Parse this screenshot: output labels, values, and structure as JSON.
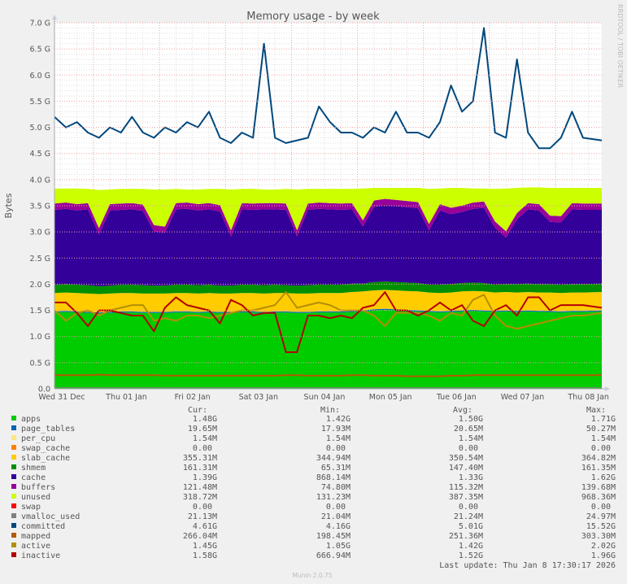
{
  "chart_data": {
    "type": "area",
    "title": "Memory usage - by week",
    "ylabel": "Bytes",
    "watermark": "RRDTOOL / TOBI OETIKER",
    "footer": "Munin 2.0.75",
    "last_update": "Last update: Thu Jan  8 17:30:17 2026",
    "ylim": [
      0,
      7.0
    ],
    "y_unit": "G",
    "y_ticks": [
      "0.0",
      "0.5 G",
      "1.0 G",
      "1.5 G",
      "2.0 G",
      "2.5 G",
      "3.0 G",
      "3.5 G",
      "4.0 G",
      "4.5 G",
      "5.0 G",
      "5.5 G",
      "6.0 G",
      "6.5 G",
      "7.0 G"
    ],
    "y_tick_values": [
      0,
      0.5,
      1.0,
      1.5,
      2.0,
      2.5,
      3.0,
      3.5,
      4.0,
      4.5,
      5.0,
      5.5,
      6.0,
      6.5,
      7.0
    ],
    "xlim": [
      "2025-12-31T09:50",
      "2026-01-08T16:50"
    ],
    "x_ticks": [
      {
        "label": "Wed 31 Dec",
        "t": "2025-12-31T12:00"
      },
      {
        "label": "Thu 01 Jan",
        "t": "2026-01-01T12:00"
      },
      {
        "label": "Fri 02 Jan",
        "t": "2026-01-02T12:00"
      },
      {
        "label": "Sat 03 Jan",
        "t": "2026-01-03T12:00"
      },
      {
        "label": "Sun 04 Jan",
        "t": "2026-01-04T12:00"
      },
      {
        "label": "Mon 05 Jan",
        "t": "2026-01-05T12:00"
      },
      {
        "label": "Tue 06 Jan",
        "t": "2026-01-06T12:00"
      },
      {
        "label": "Wed 07 Jan",
        "t": "2026-01-07T12:00"
      },
      {
        "label": "Thu 08 Jan",
        "t": "2026-01-08T12:00"
      }
    ],
    "grid": true,
    "x_start": "2025-12-31T10:00",
    "x_step_hours": 4,
    "legend_headers": [
      "Cur:",
      "Min:",
      "Avg:",
      "Max:"
    ],
    "series": [
      {
        "name": "apps",
        "color": "#00CC00",
        "draw": "area",
        "cur": "1.48G",
        "min": "1.42G",
        "avg": "1.50G",
        "max": "1.71G",
        "values": [
          1.46,
          1.47,
          1.46,
          1.45,
          1.44,
          1.45,
          1.46,
          1.46,
          1.45,
          1.45,
          1.45,
          1.46,
          1.46,
          1.45,
          1.46,
          1.45,
          1.45,
          1.46,
          1.46,
          1.45,
          1.46,
          1.46,
          1.45,
          1.45,
          1.46,
          1.46,
          1.46,
          1.47,
          1.48,
          1.5,
          1.51,
          1.5,
          1.49,
          1.48,
          1.47,
          1.46,
          1.47,
          1.48,
          1.49,
          1.48,
          1.47,
          1.48,
          1.47,
          1.48,
          1.47,
          1.47,
          1.46,
          1.47,
          1.47,
          1.48
        ]
      },
      {
        "name": "page_tables",
        "color": "#0066B3",
        "draw": "area",
        "cur": "19.65M",
        "min": "17.93M",
        "avg": "20.65M",
        "max": "50.27M",
        "values": [
          0.02,
          0.02,
          0.02,
          0.02,
          0.02,
          0.02,
          0.02,
          0.02,
          0.02,
          0.02,
          0.02,
          0.02,
          0.02,
          0.02,
          0.02,
          0.02,
          0.02,
          0.02,
          0.02,
          0.02,
          0.02,
          0.02,
          0.02,
          0.02,
          0.02,
          0.02,
          0.02,
          0.02,
          0.02,
          0.02,
          0.02,
          0.02,
          0.02,
          0.02,
          0.02,
          0.02,
          0.02,
          0.02,
          0.02,
          0.02,
          0.02,
          0.02,
          0.02,
          0.02,
          0.02,
          0.02,
          0.02,
          0.02,
          0.02,
          0.02
        ]
      },
      {
        "name": "per_cpu",
        "color": "#FFE680",
        "draw": "area",
        "cur": "1.54M",
        "min": "1.54M",
        "avg": "1.54M",
        "max": "1.54M",
        "values": [
          0.0015,
          0.0015,
          0.0015,
          0.0015,
          0.0015,
          0.0015,
          0.0015,
          0.0015,
          0.0015,
          0.0015,
          0.0015,
          0.0015,
          0.0015,
          0.0015,
          0.0015,
          0.0015,
          0.0015,
          0.0015,
          0.0015,
          0.0015,
          0.0015,
          0.0015,
          0.0015,
          0.0015,
          0.0015,
          0.0015,
          0.0015,
          0.0015,
          0.0015,
          0.0015,
          0.0015,
          0.0015,
          0.0015,
          0.0015,
          0.0015,
          0.0015,
          0.0015,
          0.0015,
          0.0015,
          0.0015,
          0.0015,
          0.0015,
          0.0015,
          0.0015,
          0.0015,
          0.0015,
          0.0015,
          0.0015,
          0.0015,
          0.0015
        ]
      },
      {
        "name": "swap_cache",
        "color": "#FF8000",
        "draw": "area",
        "cur": "0.00",
        "min": "0.00",
        "avg": "0.00",
        "max": "0.00",
        "values": [
          0,
          0,
          0,
          0,
          0,
          0,
          0,
          0,
          0,
          0,
          0,
          0,
          0,
          0,
          0,
          0,
          0,
          0,
          0,
          0,
          0,
          0,
          0,
          0,
          0,
          0,
          0,
          0,
          0,
          0,
          0,
          0,
          0,
          0,
          0,
          0,
          0,
          0,
          0,
          0,
          0,
          0,
          0,
          0,
          0,
          0,
          0,
          0,
          0,
          0
        ]
      },
      {
        "name": "slab_cache",
        "color": "#FFCC00",
        "draw": "area",
        "cur": "355.31M",
        "min": "344.94M",
        "avg": "350.54M",
        "max": "364.82M",
        "values": [
          0.35,
          0.35,
          0.35,
          0.35,
          0.35,
          0.35,
          0.35,
          0.35,
          0.35,
          0.35,
          0.35,
          0.35,
          0.35,
          0.35,
          0.35,
          0.35,
          0.35,
          0.35,
          0.35,
          0.35,
          0.35,
          0.35,
          0.35,
          0.35,
          0.35,
          0.35,
          0.35,
          0.36,
          0.36,
          0.36,
          0.36,
          0.36,
          0.36,
          0.36,
          0.35,
          0.35,
          0.35,
          0.36,
          0.36,
          0.36,
          0.35,
          0.35,
          0.35,
          0.35,
          0.35,
          0.35,
          0.35,
          0.35,
          0.35,
          0.35
        ]
      },
      {
        "name": "shmem",
        "color": "#008F00",
        "draw": "area",
        "cur": "161.31M",
        "min": "65.31M",
        "avg": "147.40M",
        "max": "161.35M",
        "values": [
          0.16,
          0.16,
          0.16,
          0.16,
          0.15,
          0.15,
          0.16,
          0.16,
          0.16,
          0.15,
          0.15,
          0.16,
          0.16,
          0.16,
          0.16,
          0.15,
          0.15,
          0.16,
          0.16,
          0.16,
          0.16,
          0.15,
          0.15,
          0.16,
          0.16,
          0.16,
          0.16,
          0.16,
          0.15,
          0.16,
          0.16,
          0.16,
          0.16,
          0.16,
          0.15,
          0.16,
          0.16,
          0.16,
          0.16,
          0.16,
          0.15,
          0.15,
          0.16,
          0.16,
          0.16,
          0.16,
          0.16,
          0.16,
          0.16,
          0.16
        ]
      },
      {
        "name": "cache",
        "color": "#330099",
        "draw": "area",
        "cur": "1.39G",
        "min": "868.14M",
        "avg": "1.33G",
        "max": "1.62G",
        "values": [
          1.43,
          1.44,
          1.42,
          1.45,
          0.99,
          1.44,
          1.43,
          1.44,
          1.42,
          1.04,
          1.01,
          1.44,
          1.45,
          1.43,
          1.44,
          1.42,
          0.94,
          1.44,
          1.43,
          1.45,
          1.44,
          1.44,
          0.94,
          1.44,
          1.45,
          1.44,
          1.43,
          1.42,
          1.09,
          1.44,
          1.46,
          1.45,
          1.44,
          1.43,
          1.04,
          1.42,
          1.34,
          1.36,
          1.41,
          1.44,
          1.09,
          0.89,
          1.24,
          1.42,
          1.41,
          1.19,
          1.19,
          1.43,
          1.42,
          1.41
        ]
      },
      {
        "name": "buffers",
        "color": "#990099",
        "draw": "area",
        "cur": "121.48M",
        "min": "74.80M",
        "avg": "115.32M",
        "max": "139.68M",
        "values": [
          0.12,
          0.12,
          0.12,
          0.12,
          0.12,
          0.12,
          0.12,
          0.12,
          0.12,
          0.12,
          0.12,
          0.12,
          0.12,
          0.12,
          0.12,
          0.12,
          0.12,
          0.12,
          0.12,
          0.12,
          0.12,
          0.12,
          0.12,
          0.12,
          0.12,
          0.12,
          0.12,
          0.12,
          0.12,
          0.12,
          0.12,
          0.12,
          0.12,
          0.12,
          0.12,
          0.12,
          0.12,
          0.12,
          0.12,
          0.12,
          0.12,
          0.12,
          0.12,
          0.12,
          0.12,
          0.12,
          0.12,
          0.12,
          0.12,
          0.12
        ]
      },
      {
        "name": "unused",
        "color": "#CCFF00",
        "draw": "area",
        "cur": "318.72M",
        "min": "131.23M",
        "avg": "387.35M",
        "max": "968.36M",
        "values": [
          0.29,
          0.27,
          0.3,
          0.27,
          0.73,
          0.28,
          0.28,
          0.27,
          0.3,
          0.68,
          0.71,
          0.27,
          0.25,
          0.28,
          0.27,
          0.31,
          0.78,
          0.27,
          0.28,
          0.26,
          0.26,
          0.28,
          0.78,
          0.28,
          0.26,
          0.27,
          0.28,
          0.27,
          0.61,
          0.24,
          0.21,
          0.23,
          0.25,
          0.27,
          0.67,
          0.3,
          0.38,
          0.34,
          0.27,
          0.25,
          0.62,
          0.82,
          0.48,
          0.3,
          0.32,
          0.53,
          0.54,
          0.29,
          0.3,
          0.3
        ]
      },
      {
        "name": "swap",
        "color": "#FF0000",
        "draw": "area",
        "cur": "0.00",
        "min": "0.00",
        "avg": "0.00",
        "max": "0.00",
        "values": [
          0,
          0,
          0,
          0,
          0,
          0,
          0,
          0,
          0,
          0,
          0,
          0,
          0,
          0,
          0,
          0,
          0,
          0,
          0,
          0,
          0,
          0,
          0,
          0,
          0,
          0,
          0,
          0,
          0,
          0,
          0,
          0,
          0,
          0,
          0,
          0,
          0,
          0,
          0,
          0,
          0,
          0,
          0,
          0,
          0,
          0,
          0,
          0,
          0,
          0
        ]
      },
      {
        "name": "vmalloc_used",
        "color": "#808080",
        "draw": "line",
        "cur": "21.13M",
        "min": "21.04M",
        "avg": "21.24M",
        "max": "24.97M",
        "values": [
          0.021,
          0.021,
          0.021,
          0.021,
          0.021,
          0.021,
          0.021,
          0.021,
          0.021,
          0.021,
          0.021,
          0.021,
          0.021,
          0.021,
          0.021,
          0.021,
          0.021,
          0.021,
          0.021,
          0.021,
          0.021,
          0.021,
          0.021,
          0.021,
          0.021,
          0.021,
          0.021,
          0.021,
          0.021,
          0.021,
          0.021,
          0.021,
          0.021,
          0.021,
          0.021,
          0.021,
          0.021,
          0.021,
          0.021,
          0.021,
          0.021,
          0.021,
          0.021,
          0.021,
          0.021,
          0.021,
          0.021,
          0.021,
          0.021,
          0.021
        ]
      },
      {
        "name": "committed",
        "color": "#00487D",
        "draw": "line",
        "cur": "4.61G",
        "min": "4.16G",
        "avg": "5.01G",
        "max": "15.52G",
        "values": [
          5.2,
          5.0,
          5.1,
          4.9,
          4.8,
          5.0,
          4.9,
          5.2,
          4.9,
          4.8,
          5.0,
          4.9,
          5.1,
          5.0,
          5.3,
          4.8,
          4.7,
          4.9,
          4.8,
          6.6,
          4.8,
          4.7,
          4.75,
          4.8,
          5.4,
          5.1,
          4.9,
          4.9,
          4.8,
          5.0,
          4.9,
          5.3,
          4.9,
          4.9,
          4.8,
          5.1,
          5.8,
          5.3,
          5.5,
          6.9,
          4.9,
          4.8,
          6.3,
          4.9,
          4.6,
          4.6,
          4.8,
          5.3,
          4.8,
          4.75
        ]
      },
      {
        "name": "mapped",
        "color": "#B35A00",
        "draw": "line",
        "cur": "266.04M",
        "min": "198.45M",
        "avg": "251.36M",
        "max": "303.30M",
        "values": [
          0.26,
          0.26,
          0.26,
          0.26,
          0.27,
          0.26,
          0.26,
          0.26,
          0.26,
          0.26,
          0.25,
          0.25,
          0.25,
          0.25,
          0.25,
          0.25,
          0.25,
          0.25,
          0.25,
          0.25,
          0.25,
          0.26,
          0.26,
          0.25,
          0.25,
          0.25,
          0.25,
          0.26,
          0.26,
          0.25,
          0.25,
          0.25,
          0.24,
          0.24,
          0.24,
          0.24,
          0.25,
          0.25,
          0.26,
          0.26,
          0.26,
          0.26,
          0.26,
          0.26,
          0.26,
          0.26,
          0.26,
          0.26,
          0.26,
          0.26
        ]
      },
      {
        "name": "active",
        "color": "#B38F00",
        "draw": "line",
        "cur": "1.45G",
        "min": "1.05G",
        "avg": "1.42G",
        "max": "2.02G",
        "values": [
          1.5,
          1.3,
          1.45,
          1.5,
          1.4,
          1.5,
          1.55,
          1.6,
          1.6,
          1.3,
          1.35,
          1.3,
          1.4,
          1.4,
          1.35,
          1.4,
          1.45,
          1.5,
          1.5,
          1.55,
          1.6,
          1.85,
          1.55,
          1.6,
          1.65,
          1.6,
          1.5,
          1.5,
          1.5,
          1.4,
          1.2,
          1.45,
          1.45,
          1.45,
          1.4,
          1.3,
          1.45,
          1.4,
          1.7,
          1.8,
          1.4,
          1.2,
          1.15,
          1.2,
          1.25,
          1.3,
          1.35,
          1.4,
          1.4,
          1.45
        ]
      },
      {
        "name": "inactive",
        "color": "#B30000",
        "draw": "line",
        "cur": "1.58G",
        "min": "666.94M",
        "avg": "1.52G",
        "max": "1.96G",
        "values": [
          1.65,
          1.65,
          1.45,
          1.2,
          1.5,
          1.5,
          1.45,
          1.4,
          1.4,
          1.1,
          1.55,
          1.75,
          1.6,
          1.55,
          1.5,
          1.25,
          1.7,
          1.6,
          1.4,
          1.45,
          1.45,
          0.7,
          0.7,
          1.4,
          1.4,
          1.35,
          1.4,
          1.35,
          1.55,
          1.6,
          1.85,
          1.5,
          1.5,
          1.4,
          1.5,
          1.65,
          1.5,
          1.6,
          1.3,
          1.2,
          1.5,
          1.6,
          1.4,
          1.75,
          1.75,
          1.5,
          1.6,
          1.6,
          1.6,
          1.55
        ]
      }
    ]
  }
}
